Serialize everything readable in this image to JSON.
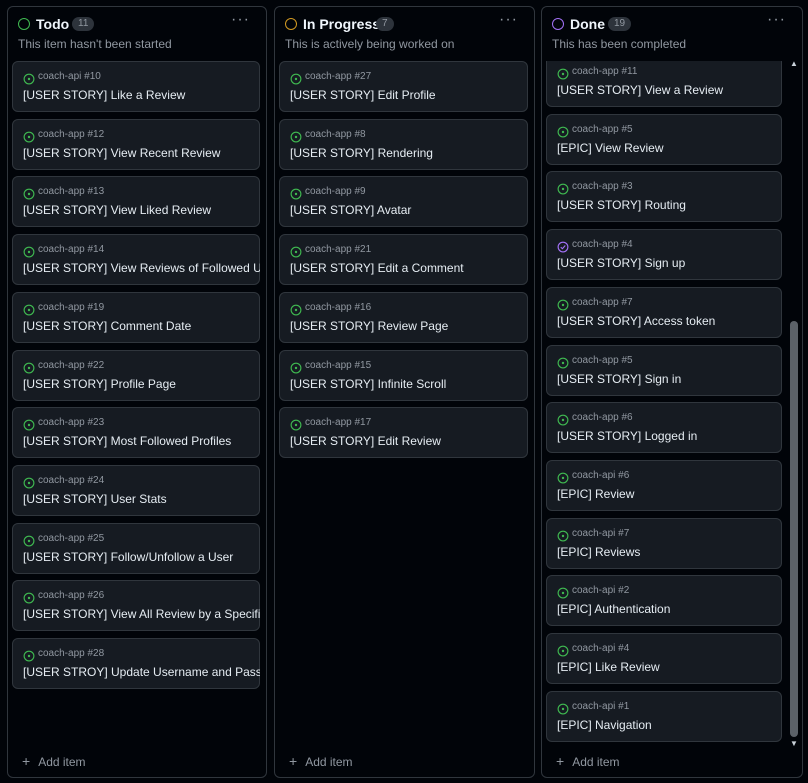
{
  "columns": [
    {
      "title": "Todo",
      "count": "11",
      "description": "This item hasn't been started",
      "status_color": "#3fb950",
      "more_label": "···",
      "add_label": "Add item",
      "cards": [
        {
          "ref": "coach-api #10",
          "title": "[USER STORY] Like a Review",
          "state": "open"
        },
        {
          "ref": "coach-app #12",
          "title": "[USER STORY] View Recent Review",
          "state": "open"
        },
        {
          "ref": "coach-app #13",
          "title": "[USER STORY] View Liked Review",
          "state": "open"
        },
        {
          "ref": "coach-app #14",
          "title": "[USER STORY] View Reviews of Followed Users",
          "state": "open"
        },
        {
          "ref": "coach-app #19",
          "title": "[USER STORY] Comment Date",
          "state": "open"
        },
        {
          "ref": "coach-app #22",
          "title": "[USER STORY] Profile Page",
          "state": "open"
        },
        {
          "ref": "coach-app #23",
          "title": "[USER STORY] Most Followed Profiles",
          "state": "open"
        },
        {
          "ref": "coach-app #24",
          "title": "[USER STORY] User Stats",
          "state": "open"
        },
        {
          "ref": "coach-app #25",
          "title": "[USER STORY] Follow/Unfollow a User",
          "state": "open"
        },
        {
          "ref": "coach-app #26",
          "title": "[USER STORY] View All Review by a Specific User",
          "state": "open"
        },
        {
          "ref": "coach-app #28",
          "title": "[USER STROY] Update Username and Password",
          "state": "open"
        }
      ]
    },
    {
      "title": "In Progress",
      "count": "7",
      "description": "This is actively being worked on",
      "status_color": "#d29922",
      "more_label": "···",
      "add_label": "Add item",
      "cards": [
        {
          "ref": "coach-app #27",
          "title": "[USER STORY] Edit Profile",
          "state": "open"
        },
        {
          "ref": "coach-app #8",
          "title": "[USER STORY] Rendering",
          "state": "open"
        },
        {
          "ref": "coach-app #9",
          "title": "[USER STORY] Avatar",
          "state": "open"
        },
        {
          "ref": "coach-app #21",
          "title": "[USER STORY] Edit a Comment",
          "state": "open"
        },
        {
          "ref": "coach-app #16",
          "title": "[USER STORY] Review Page",
          "state": "open"
        },
        {
          "ref": "coach-app #15",
          "title": "[USER STORY] Infinite Scroll",
          "state": "open"
        },
        {
          "ref": "coach-app #17",
          "title": "[USER STORY] Edit Review",
          "state": "open"
        }
      ]
    },
    {
      "title": "Done",
      "count": "19",
      "description": "This has been completed",
      "status_color": "#a371f7",
      "more_label": "···",
      "add_label": "Add item",
      "cards": [
        {
          "ref": "coach-app #11",
          "title": "[USER STORY] View a Review",
          "state": "open"
        },
        {
          "ref": "coach-app #5",
          "title": "[EPIC] View Review",
          "state": "open"
        },
        {
          "ref": "coach-app #3",
          "title": "[USER STORY] Routing",
          "state": "open"
        },
        {
          "ref": "coach-app #4",
          "title": "[USER STORY] Sign up",
          "state": "closed"
        },
        {
          "ref": "coach-app #7",
          "title": "[USER STORY] Access token",
          "state": "open"
        },
        {
          "ref": "coach-app #5",
          "title": "[USER STORY] Sign in",
          "state": "open"
        },
        {
          "ref": "coach-app #6",
          "title": "[USER STORY] Logged in",
          "state": "open"
        },
        {
          "ref": "coach-api #6",
          "title": "[EPIC] Review",
          "state": "open"
        },
        {
          "ref": "coach-api #7",
          "title": "[EPIC] Reviews",
          "state": "open"
        },
        {
          "ref": "coach-api #2",
          "title": "[EPIC] Authentication",
          "state": "open"
        },
        {
          "ref": "coach-api #4",
          "title": "[EPIC] Like Review",
          "state": "open"
        },
        {
          "ref": "coach-api #1",
          "title": "[EPIC] Navigation",
          "state": "open"
        }
      ]
    }
  ],
  "colors": {
    "open_issue": "#3fb950",
    "closed_issue": "#a371f7"
  }
}
